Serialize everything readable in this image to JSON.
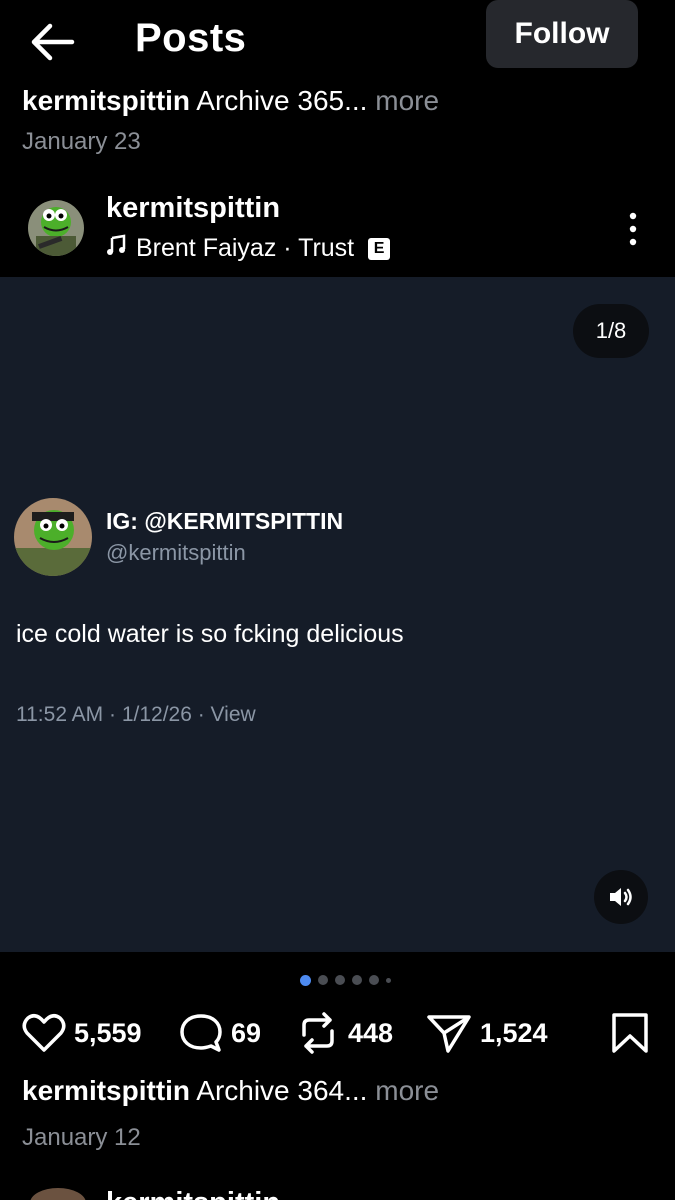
{
  "header": {
    "title": "Posts",
    "follow_label": "Follow"
  },
  "previous_post": {
    "username": "kermitspittin",
    "caption": "Archive 365...",
    "more": "more",
    "date": "January 23"
  },
  "post": {
    "username": "kermitspittin",
    "song": "Brent Faiyaz · Trust",
    "explicit_badge": "E",
    "pager": "1/8",
    "embedded": {
      "display_name": "IG: @KERMITSPITTIN",
      "handle": "@kermitspittin",
      "text": "ice cold water is so fcking delicious",
      "meta": "11:52 AM · 1/12/26 · View"
    },
    "carousel": {
      "total": 8,
      "active_index": 0
    },
    "stats": {
      "likes": "5,559",
      "comments": "69",
      "reposts": "448",
      "shares": "1,524"
    },
    "caption_username": "kermitspittin",
    "caption": "Archive 364...",
    "more": "more",
    "date": "January 12"
  },
  "next_post": {
    "username": "kermitspittin"
  },
  "colors": {
    "background": "#000000",
    "media_bg": "#151c28",
    "muted": "#8b8f96",
    "dot_active": "#4d8af0"
  }
}
